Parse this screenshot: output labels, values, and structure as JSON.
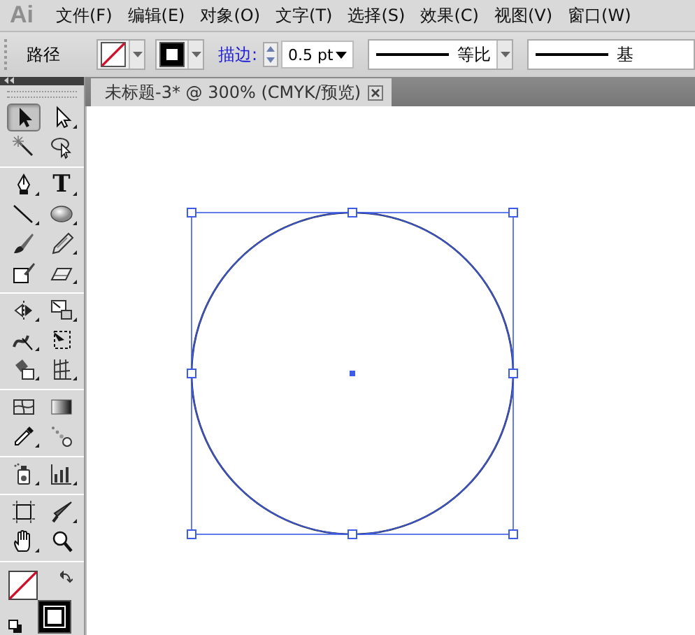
{
  "app": {
    "logo": "Ai"
  },
  "menu": [
    {
      "label": "文件(F)"
    },
    {
      "label": "编辑(E)"
    },
    {
      "label": "对象(O)"
    },
    {
      "label": "文字(T)"
    },
    {
      "label": "选择(S)"
    },
    {
      "label": "效果(C)"
    },
    {
      "label": "视图(V)"
    },
    {
      "label": "窗口(W)"
    }
  ],
  "control_bar": {
    "selection_label": "路径",
    "fill_none": true,
    "stroke_label": "描边:",
    "stroke_weight": "0.5 pt",
    "profile_label": "等比",
    "brush_label": "基"
  },
  "toolbox": {
    "groups": [
      [
        {
          "kind": "selection",
          "selected": true
        },
        {
          "kind": "direct-selection",
          "selected": false
        },
        {
          "kind": "magic-wand",
          "selected": false
        },
        {
          "kind": "lasso",
          "selected": false
        }
      ],
      [
        {
          "kind": "pen",
          "selected": false
        },
        {
          "kind": "type",
          "label": "T",
          "selected": false
        },
        {
          "kind": "line",
          "selected": false
        },
        {
          "kind": "ellipse",
          "selected": false
        },
        {
          "kind": "paintbrush",
          "selected": false
        },
        {
          "kind": "pencil",
          "selected": false
        },
        {
          "kind": "blob-brush",
          "selected": false
        },
        {
          "kind": "eraser",
          "selected": false
        }
      ],
      [
        {
          "kind": "reflect",
          "selected": false
        },
        {
          "kind": "scale",
          "selected": false
        },
        {
          "kind": "warp",
          "selected": false
        },
        {
          "kind": "free-transform",
          "selected": false
        },
        {
          "kind": "live-paint",
          "selected": false
        },
        {
          "kind": "perspective-grid",
          "selected": false
        }
      ],
      [
        {
          "kind": "mesh",
          "selected": false
        },
        {
          "kind": "gradient",
          "selected": false
        },
        {
          "kind": "eyedropper",
          "selected": false
        },
        {
          "kind": "blend",
          "selected": false
        }
      ],
      [
        {
          "kind": "symbol-sprayer",
          "selected": false
        },
        {
          "kind": "graph",
          "selected": false
        }
      ],
      [
        {
          "kind": "artboard",
          "selected": false
        },
        {
          "kind": "slice",
          "selected": false
        },
        {
          "kind": "hand",
          "selected": false
        },
        {
          "kind": "zoom",
          "selected": false
        }
      ]
    ],
    "fill_none": true
  },
  "document_tab": {
    "title": "未标题-3* @ 300% (CMYK/预览)",
    "selected": true
  },
  "canvas": {
    "selected": true
  }
}
